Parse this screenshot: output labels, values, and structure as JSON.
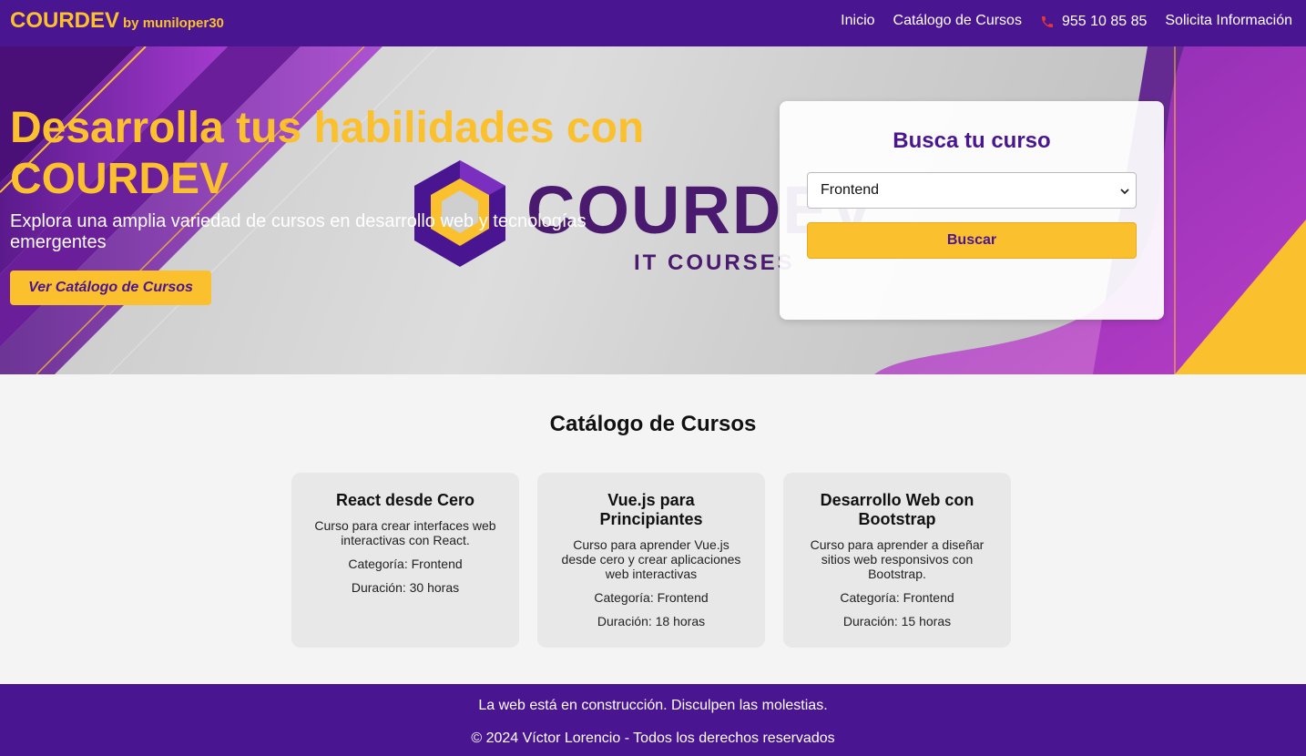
{
  "header": {
    "brand": "COURDEV",
    "brand_sub": "by muniloper30",
    "nav": {
      "inicio": "Inicio",
      "catalogo": "Catálogo de Cursos",
      "phone": "955 10 85 85",
      "info": "Solicita Información"
    },
    "phone_icon": "phone-icon"
  },
  "hero": {
    "title": "Desarrolla tus habilidades con COURDEV",
    "subtitle": "Explora una amplia variedad de cursos en desarrollo web y tecnologías emergentes",
    "cta": "Ver Catálogo de Cursos",
    "logo_text": "COURDEV",
    "logo_tagline": "IT COURSES"
  },
  "search": {
    "title": "Busca tu curso",
    "selected": "Frontend",
    "button": "Buscar"
  },
  "catalog": {
    "title": "Catálogo de Cursos",
    "courses": [
      {
        "title": "React desde Cero",
        "description": "Curso para crear interfaces web interactivas con React.",
        "category": "Categoría: Frontend",
        "duration": "Duración: 30 horas"
      },
      {
        "title": "Vue.js para Principiantes",
        "description": "Curso para aprender Vue.js desde cero y crear aplicaciones web interactivas",
        "category": "Categoría: Frontend",
        "duration": "Duración: 18 horas"
      },
      {
        "title": "Desarrollo Web con Bootstrap",
        "description": "Curso para aprender a diseñar sitios web responsivos con Bootstrap.",
        "category": "Categoría: Frontend",
        "duration": "Duración: 15 horas"
      }
    ]
  },
  "footer": {
    "notice": "La web está en construcción. Disculpen las molestias.",
    "copyright": "© 2024 Víctor Lorencio - Todos los derechos reservados"
  },
  "colors": {
    "primary": "#4a1590",
    "accent": "#fbc02d",
    "phone_icon": "#e53935"
  }
}
